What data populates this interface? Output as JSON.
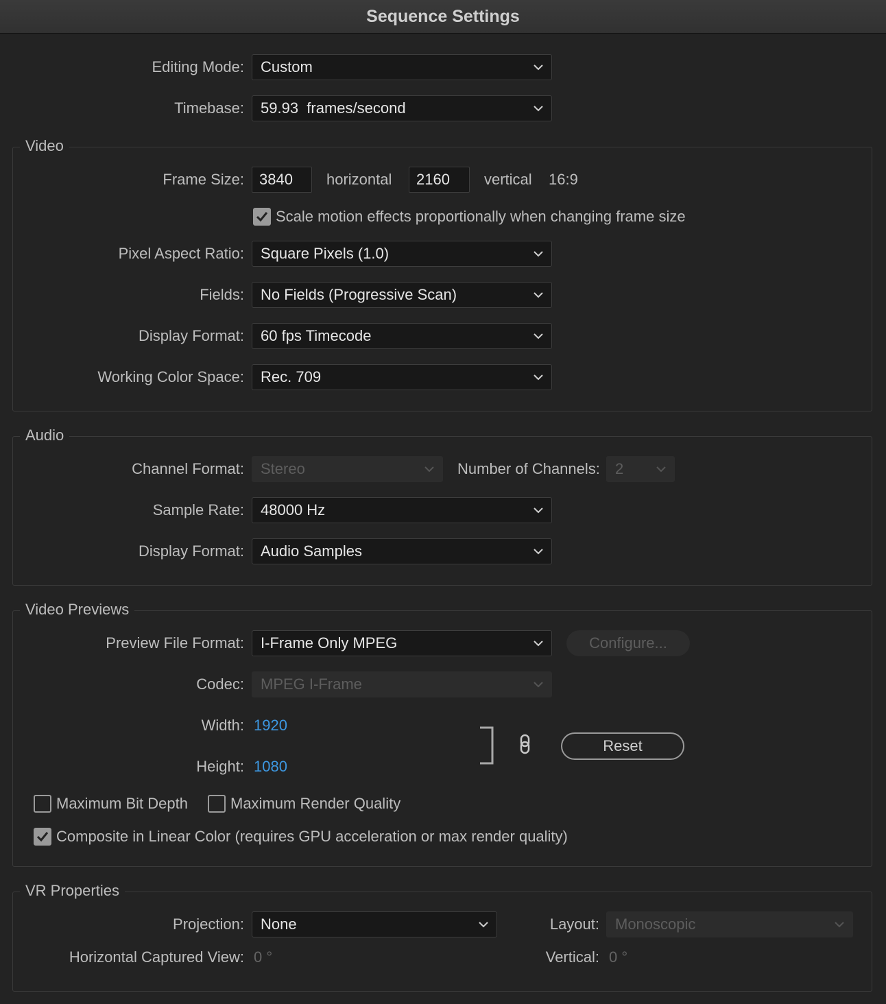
{
  "window": {
    "title": "Sequence Settings"
  },
  "general": {
    "editing_mode_label": "Editing Mode:",
    "editing_mode_value": "Custom",
    "timebase_label": "Timebase:",
    "timebase_value": "59.93  frames/second"
  },
  "video": {
    "legend": "Video",
    "frame_size_label": "Frame Size:",
    "frame_width": "3840",
    "horizontal_label": "horizontal",
    "frame_height": "2160",
    "vertical_label": "vertical",
    "aspect": "16:9",
    "scale_motion_label": "Scale motion effects proportionally when changing frame size",
    "scale_motion_checked": true,
    "pixel_aspect_label": "Pixel Aspect Ratio:",
    "pixel_aspect_value": "Square Pixels (1.0)",
    "fields_label": "Fields:",
    "fields_value": "No Fields (Progressive Scan)",
    "display_format_label": "Display Format:",
    "display_format_value": "60 fps Timecode",
    "color_space_label": "Working Color Space:",
    "color_space_value": "Rec. 709"
  },
  "audio": {
    "legend": "Audio",
    "channel_format_label": "Channel Format:",
    "channel_format_value": "Stereo",
    "num_channels_label": "Number of Channels:",
    "num_channels_value": "2",
    "sample_rate_label": "Sample Rate:",
    "sample_rate_value": "48000 Hz",
    "display_format_label": "Display Format:",
    "display_format_value": "Audio Samples"
  },
  "previews": {
    "legend": "Video Previews",
    "file_format_label": "Preview File Format:",
    "file_format_value": "I-Frame Only MPEG",
    "configure_label": "Configure...",
    "codec_label": "Codec:",
    "codec_value": "MPEG I-Frame",
    "width_label": "Width:",
    "width_value": "1920",
    "height_label": "Height:",
    "height_value": "1080",
    "reset_label": "Reset",
    "max_bit_depth_label": "Maximum Bit Depth",
    "max_bit_depth_checked": false,
    "max_render_label": "Maximum Render Quality",
    "max_render_checked": false,
    "linear_color_label": "Composite in Linear Color (requires GPU acceleration or max render quality)",
    "linear_color_checked": true
  },
  "vr": {
    "legend": "VR Properties",
    "projection_label": "Projection:",
    "projection_value": "None",
    "layout_label": "Layout:",
    "layout_value": "Monoscopic",
    "h_view_label": "Horizontal Captured View:",
    "h_view_value": "0 °",
    "vertical_label": "Vertical:",
    "vertical_value": "0 °"
  },
  "colors": {
    "background": "#232323",
    "accent_value": "#3d97e0",
    "disabled_text": "#5d5d5d"
  }
}
